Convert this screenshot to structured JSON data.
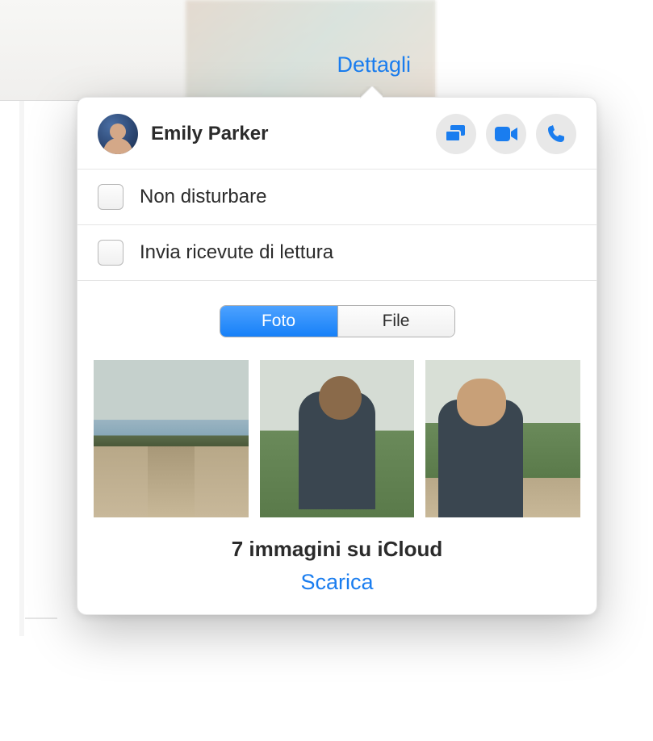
{
  "header": {
    "details_link": "Dettagli"
  },
  "contact": {
    "name": "Emily Parker"
  },
  "options": {
    "do_not_disturb": "Non disturbare",
    "read_receipts": "Invia ricevute di lettura"
  },
  "segment": {
    "photos": "Foto",
    "files": "File"
  },
  "footer": {
    "icloud_count": "7 immagini su iCloud",
    "download": "Scarica"
  }
}
